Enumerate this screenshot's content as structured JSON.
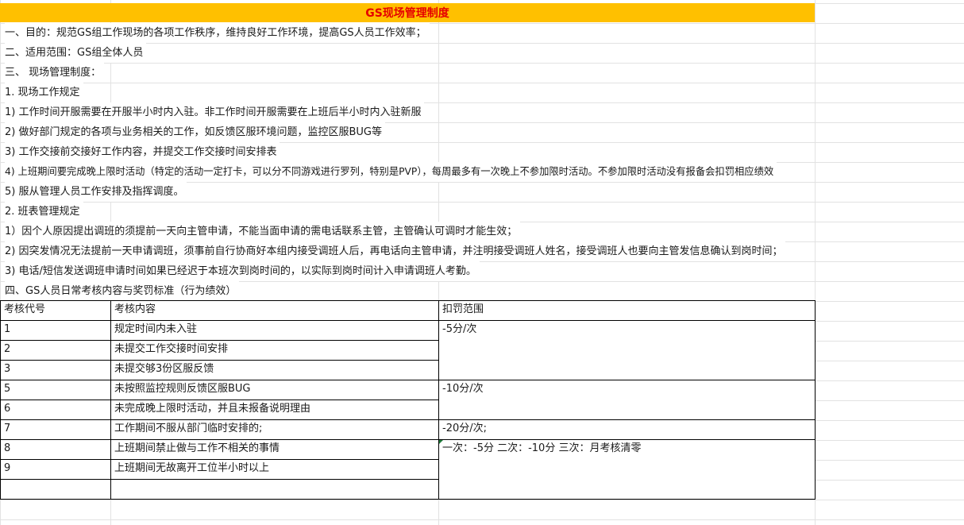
{
  "title": "GS现场管理制度",
  "lines": [
    "一、目的：规范GS组工作现场的各项工作秩序，维持良好工作环境，提高GS人员工作效率；",
    "二、适用范围：GS组全体人员",
    "三、   现场管理制度：",
    "1. 现场工作规定",
    "1)   工作时间开服需要在开服半小时内入驻。非工作时间开服需要在上班后半小时内入驻新服",
    "2)   做好部门规定的各项与业务相关的工作，如反馈区服环境问题，监控区服BUG等",
    "3)   工作交接前交接好工作内容，并提交工作交接时间安排表",
    "4)   上班期间要完成晚上限时活动（特定的活动一定打卡，可以分不同游戏进行罗列，特别是PVP），每周最多有一次晚上不参加限时活动。不参加限时活动没有报备会扣罚相应绩效",
    "5)   服从管理人员工作安排及指挥调度。",
    "2.   班表管理规定",
    "1）因个人原因提出调班的须提前一天向主管申请，不能当面申请的需电话联系主管，主管确认可调时才能生效；",
    "2)   因突发情况无法提前一天申请调班，须事前自行协商好本组内接受调班人后，再电话向主管申请，并注明接受调班人姓名，接受调班人也要向主管发信息确认到岗时间；",
    "3)   电话/短信发送调班申请时间如果已经迟于本班次到岗时间的，以实际到岗时间计入申请调班人考勤。",
    "四、GS人员日常考核内容与奖罚标准（行为绩效）"
  ],
  "table": {
    "headers": [
      "考核代号",
      "考核内容",
      "扣罚范围"
    ],
    "rows": [
      {
        "code": "1",
        "content": "规定时间内未入驻"
      },
      {
        "code": "2",
        "content": "未提交工作交接时间安排"
      },
      {
        "code": "3",
        "content": "未提交够3份区服反馈"
      },
      {
        "code": "5",
        "content": "未按照监控规则反馈区服BUG"
      },
      {
        "code": "6",
        "content": "未完成晚上限时活动，并且未报备说明理由"
      },
      {
        "code": "7",
        "content": "工作期间不服从部门临时安排的;"
      },
      {
        "code": "8",
        "content": "上班期间禁止做与工作不相关的事情"
      },
      {
        "code": "9",
        "content": "上班期间无故离开工位半小时以上"
      },
      {
        "code": "",
        "content": ""
      }
    ],
    "penalties": [
      "-5分/次",
      "-10分/次",
      "-20分/次;",
      "一次：-5分 二次：-10分 三次：月考核清零"
    ]
  },
  "colors": {
    "title_bg": "#ffc000",
    "title_text": "#e60000",
    "gridline": "#e2e2e2",
    "border": "#000000"
  }
}
